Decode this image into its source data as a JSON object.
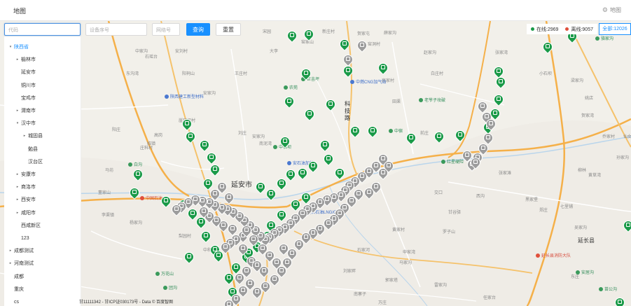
{
  "header": {
    "title": "地图",
    "map_link": "地图"
  },
  "filters": {
    "region_placeholder": "代码",
    "device_placeholder": "设备序号",
    "site_placeholder": "网络号",
    "query_label": "查询",
    "reset_label": "重置"
  },
  "tree": {
    "items": [
      {
        "label": "陕西省",
        "caret": "▾",
        "level": 0,
        "selected": true
      },
      {
        "label": "榆林市",
        "caret": "▸",
        "level": 1
      },
      {
        "label": "延安市",
        "caret": "",
        "level": 1
      },
      {
        "label": "铜川市",
        "caret": "",
        "level": 1
      },
      {
        "label": "宝鸡市",
        "caret": "",
        "level": 1
      },
      {
        "label": "渭南市",
        "caret": "▸",
        "level": 1
      },
      {
        "label": "汉中市",
        "caret": "▾",
        "level": 1
      },
      {
        "label": "城固县",
        "caret": "▸",
        "level": 2
      },
      {
        "label": "勉县",
        "caret": "",
        "level": 2
      },
      {
        "label": "汉台区",
        "caret": "",
        "level": 2
      },
      {
        "label": "安康市",
        "caret": "▸",
        "level": 1
      },
      {
        "label": "商洛市",
        "caret": "▸",
        "level": 1
      },
      {
        "label": "西安市",
        "caret": "▸",
        "level": 1
      },
      {
        "label": "咸阳市",
        "caret": "▸",
        "level": 1
      },
      {
        "label": "西咸新区",
        "caret": "",
        "level": 1
      },
      {
        "label": "123",
        "caret": "",
        "level": 1
      },
      {
        "label": "成都测试",
        "caret": "▸",
        "level": 0
      },
      {
        "label": "河南测试",
        "caret": "▸",
        "level": 0
      },
      {
        "label": "成都",
        "caret": "",
        "level": 0
      },
      {
        "label": "重庆",
        "caret": "",
        "level": 0
      },
      {
        "label": "cs",
        "caret": "",
        "level": 0
      }
    ]
  },
  "legend": {
    "online_label": "在线:2969",
    "offline_label": "离线:9057",
    "all_label": "全部:12026",
    "online_color": "#1a9a48",
    "offline_color": "#e0503c"
  },
  "map": {
    "city_label": "延安市",
    "county_label": "延长县",
    "vertical_label": "科技路",
    "copyright": "甘11111342 - 甘ICP证030173号 - Data © 百度智图",
    "places": [
      {
        "t": "宋园"
      },
      {
        "t": "中家沟"
      },
      {
        "t": "石瑶台"
      },
      {
        "t": "安刘村"
      },
      {
        "t": "东沟湾"
      },
      {
        "t": "阳祠山"
      },
      {
        "t": "王庄村"
      },
      {
        "t": "安家沟"
      },
      {
        "t": "大李"
      },
      {
        "t": "崖窑坪村"
      },
      {
        "t": "高岗"
      },
      {
        "t": "临镇"
      },
      {
        "t": "庄科村"
      },
      {
        "t": "马坊"
      },
      {
        "t": "董家山"
      },
      {
        "t": "李渠镇"
      },
      {
        "t": "杨家沟"
      },
      {
        "t": "梨园村"
      },
      {
        "t": "中和村"
      },
      {
        "t": "安家沟"
      },
      {
        "t": "南泥湾"
      },
      {
        "t": "阳庄"
      },
      {
        "t": "刘庄"
      },
      {
        "t": "窑洞村"
      },
      {
        "t": "赵家沟"
      },
      {
        "t": "白庄村"
      },
      {
        "t": "高家村"
      },
      {
        "t": "田渠"
      },
      {
        "t": "张家湾"
      },
      {
        "t": "小石坝"
      },
      {
        "t": "梁家沟"
      },
      {
        "t": "姚店"
      },
      {
        "t": "贺家湾"
      },
      {
        "t": "乔家村"
      },
      {
        "t": "仙女湾"
      },
      {
        "t": "孙家沟"
      },
      {
        "t": "黄草湾"
      },
      {
        "t": "柳林"
      },
      {
        "t": "张家滩"
      },
      {
        "t": "黑家堡"
      },
      {
        "t": "郑庄"
      },
      {
        "t": "七里铺"
      },
      {
        "t": "西沟"
      },
      {
        "t": "交口"
      },
      {
        "t": "甘谷驿"
      },
      {
        "t": "罗子山"
      },
      {
        "t": "黄家村"
      },
      {
        "t": "申家湾"
      },
      {
        "t": "马家沟"
      },
      {
        "t": "石家河"
      },
      {
        "t": "刘家畔"
      },
      {
        "t": "郭家塔"
      },
      {
        "t": "雷家沟"
      },
      {
        "t": "任家台"
      },
      {
        "t": "万庄"
      },
      {
        "t": "南寨子"
      },
      {
        "t": "薛家沟"
      },
      {
        "t": "贺家屯"
      },
      {
        "t": "新庄村"
      },
      {
        "t": "窑家山"
      },
      {
        "t": "前庄"
      },
      {
        "t": "吴家沟"
      },
      {
        "t": "东庄"
      }
    ],
    "pois": [
      {
        "t": "巨吉坪",
        "c": "green"
      },
      {
        "t": "陕西建工新型材料",
        "c": "blue"
      },
      {
        "t": "中燃CNG加气站",
        "c": "blue"
      },
      {
        "t": "老爷子坟破",
        "c": "green"
      },
      {
        "t": "中宿",
        "c": "green"
      },
      {
        "t": "红星硬险",
        "c": "green"
      },
      {
        "t": "白沟",
        "c": "green"
      },
      {
        "t": "中国石油",
        "c": "red"
      },
      {
        "t": "安石油加站",
        "c": "blue"
      },
      {
        "t": "延长石油LNG/CNG",
        "c": "blue"
      },
      {
        "t": "万花山",
        "c": "green"
      },
      {
        "t": "团沟",
        "c": "green"
      },
      {
        "t": "延长县消防大队",
        "c": "red"
      },
      {
        "t": "安居沟",
        "c": "green"
      },
      {
        "t": "苗公沟",
        "c": "green"
      },
      {
        "t": "农苑",
        "c": "green"
      },
      {
        "t": "骆家沟",
        "c": "green"
      },
      {
        "t": "中宿坝",
        "c": "green"
      }
    ]
  },
  "markers": {
    "green_count": 60,
    "gray_count": 95
  }
}
